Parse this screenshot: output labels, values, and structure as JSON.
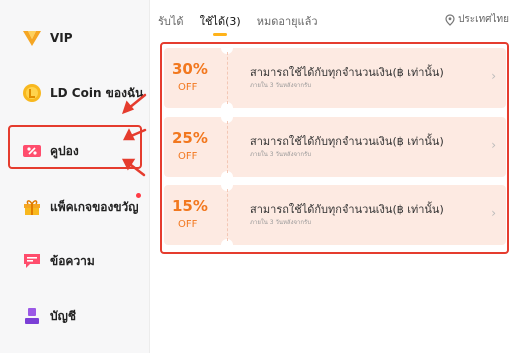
{
  "sidebar": {
    "items": [
      {
        "id": "vip",
        "label": "VIP",
        "icon": "vip-icon"
      },
      {
        "id": "coin",
        "label": "LD Coin ของฉัน",
        "icon": "coin-icon"
      },
      {
        "id": "coupon",
        "label": "คูปอง",
        "icon": "coupon-icon"
      },
      {
        "id": "gift",
        "label": "แพ็คเกจของขวัญ",
        "icon": "gift-icon"
      },
      {
        "id": "message",
        "label": "ข้อความ",
        "icon": "message-icon"
      },
      {
        "id": "account",
        "label": "บัญชี",
        "icon": "account-icon"
      }
    ],
    "selected": "coupon"
  },
  "tabs": [
    {
      "label": "รับได้",
      "active": false
    },
    {
      "label": "ใช้ได้(3)",
      "active": true
    },
    {
      "label": "หมดอายุแล้ว",
      "active": false
    }
  ],
  "country": {
    "label": "ประเทศไทย",
    "icon": "location-pin-icon"
  },
  "coupons": [
    {
      "percent": "30%",
      "off": "OFF",
      "description": "สามารถใช้ได้กับทุกจำนวนเงิน(฿ เท่านั้น)",
      "expiry": "ภายใน 3 วันหลังจากรับ"
    },
    {
      "percent": "25%",
      "off": "OFF",
      "description": "สามารถใช้ได้กับทุกจำนวนเงิน(฿ เท่านั้น)",
      "expiry": "ภายใน 3 วันหลังจากรับ"
    },
    {
      "percent": "15%",
      "off": "OFF",
      "description": "สามารถใช้ได้กับทุกจำนวนเงิน(฿ เท่านั้น)",
      "expiry": "ภายใน 3 วันหลังจากรับ"
    }
  ],
  "colors": {
    "accent": "#f2781f",
    "highlight": "#e53c2e",
    "coupon_bg": "#fdeae2",
    "tab_indicator": "#ffb31a"
  }
}
